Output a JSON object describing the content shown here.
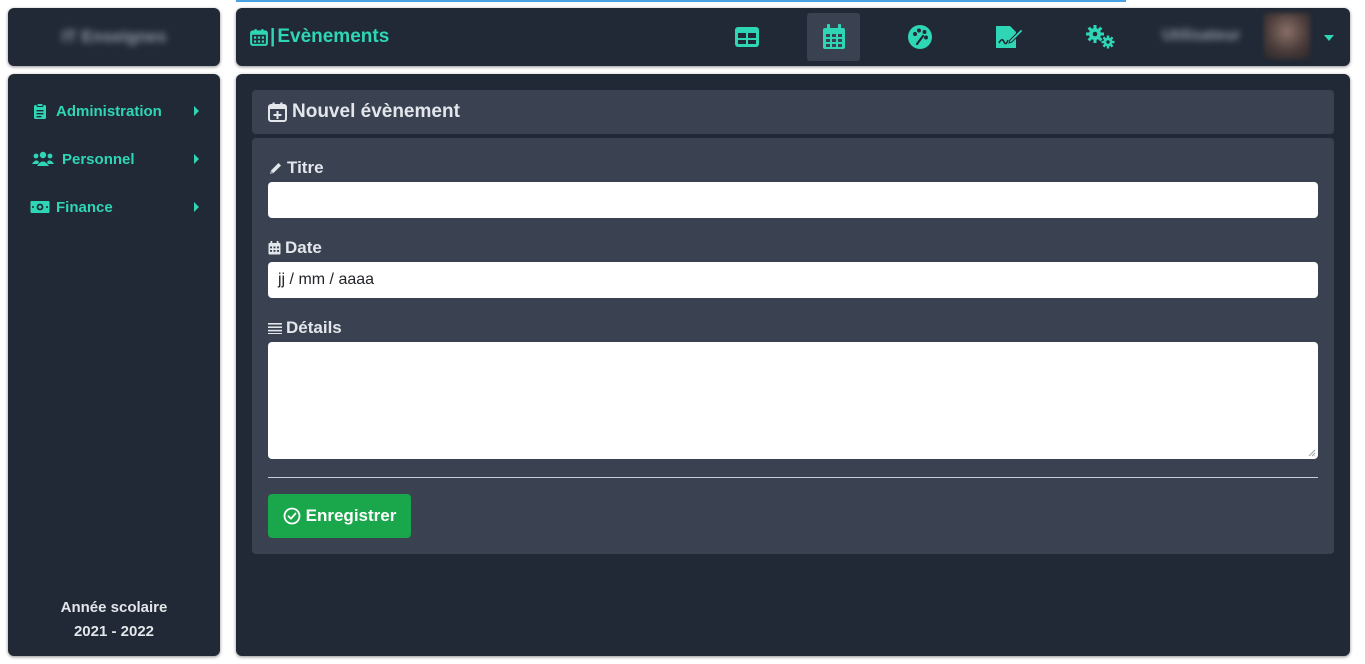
{
  "brand": {
    "name": "IT Enseignes"
  },
  "header": {
    "title": "Evènements",
    "nav": [
      {
        "icon": "table-icon",
        "active": false
      },
      {
        "icon": "calendar-icon",
        "active": true
      },
      {
        "icon": "palette-icon",
        "active": false
      },
      {
        "icon": "signature-icon",
        "active": false
      },
      {
        "icon": "cogs-icon",
        "active": false
      }
    ],
    "user": {
      "name": "Utilisateur"
    }
  },
  "sidebar": {
    "items": [
      {
        "label": "Administration",
        "icon": "clipboard-icon"
      },
      {
        "label": "Personnel",
        "icon": "users-icon"
      },
      {
        "label": "Finance",
        "icon": "money-icon"
      }
    ],
    "footer": {
      "line1": "Année scolaire",
      "line2": "2021 - 2022"
    }
  },
  "form": {
    "heading": "Nouvel évènement",
    "fields": {
      "title": {
        "label": "Titre",
        "value": ""
      },
      "date": {
        "label": "Date",
        "placeholder": "jj / mm / aaaa"
      },
      "details": {
        "label": "Détails",
        "value": ""
      }
    },
    "submit_label": "Enregistrer"
  },
  "colors": {
    "accent": "#2fd6b5",
    "panel": "#212936",
    "panel_light": "#3a4252",
    "success": "#1aa64a",
    "top_line": "#4aa3e0"
  }
}
